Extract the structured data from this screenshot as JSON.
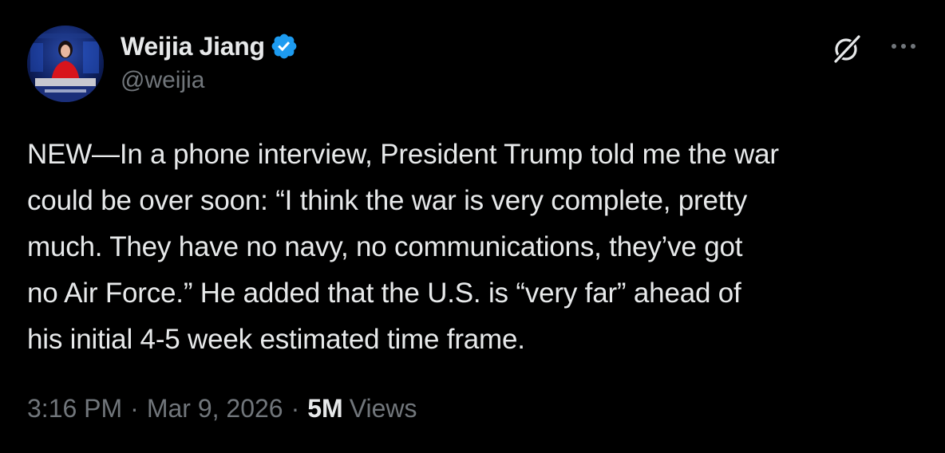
{
  "author": {
    "display_name": "Weijia Jiang",
    "handle": "@weijia",
    "verified_icon": "verified-badge-icon",
    "verified_color": "#1d9bf0"
  },
  "actions": {
    "grok_icon": "grok-icon",
    "more_icon": "more-options-icon"
  },
  "tweet": {
    "lines": [
      "NEW—In a phone interview, President Trump told me the war",
      "could be over soon: “I think the war is very complete, pretty",
      "much. They have no navy, no communications, they’ve got",
      "no Air Force.” He added that the U.S. is “very far” ahead of",
      "his initial 4-5 week estimated time frame."
    ]
  },
  "meta": {
    "time": "3:16 PM",
    "date": "Mar 9, 2026",
    "separator": "·",
    "views_count": "5M",
    "views_label": "Views"
  },
  "colors": {
    "background": "#000000",
    "primary_text": "#e7e9ea",
    "secondary_text": "#71767b"
  }
}
